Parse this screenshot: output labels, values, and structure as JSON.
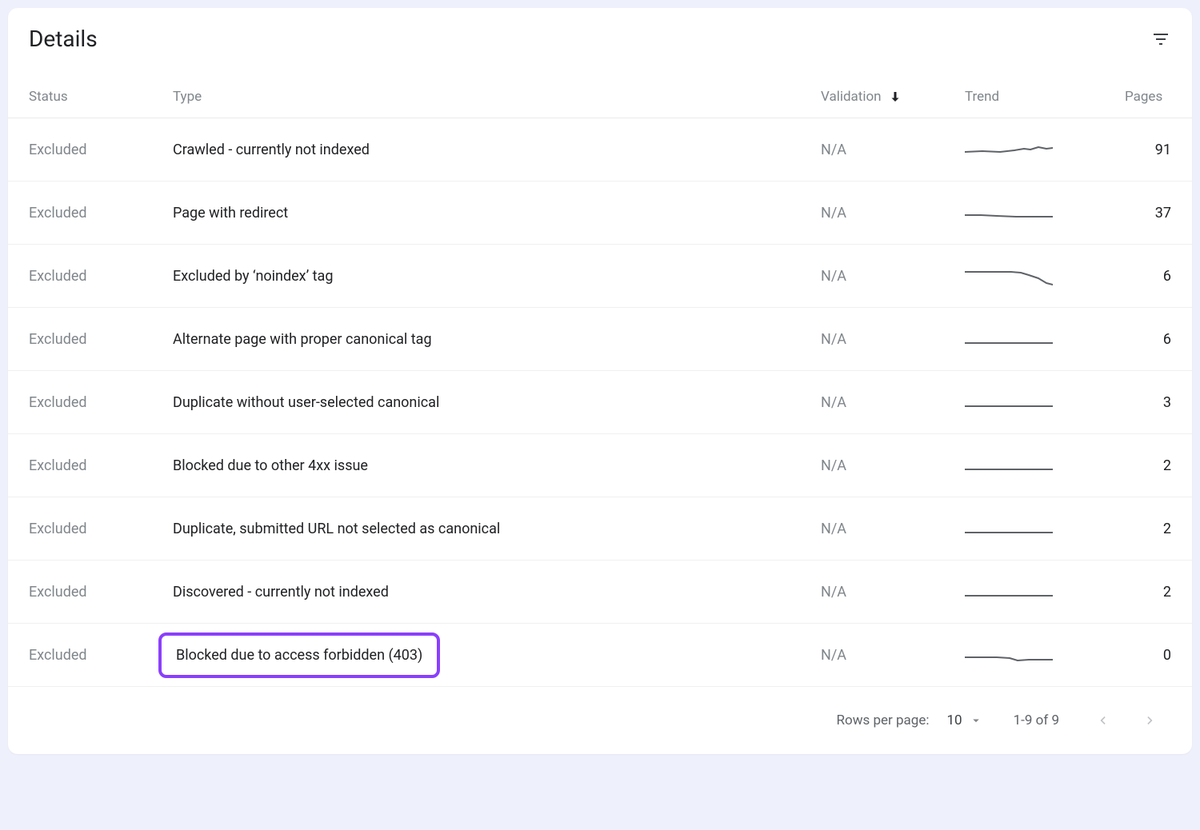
{
  "header": {
    "title": "Details"
  },
  "columns": {
    "status": "Status",
    "type": "Type",
    "validation": "Validation",
    "trend": "Trend",
    "pages": "Pages",
    "sort_column": "validation",
    "sort_direction": "desc"
  },
  "rows": [
    {
      "status": "Excluded",
      "type": "Crawled - currently not indexed",
      "validation": "N/A",
      "trend": "spark1",
      "pages": 91,
      "highlighted": false
    },
    {
      "status": "Excluded",
      "type": "Page with redirect",
      "validation": "N/A",
      "trend": "spark2",
      "pages": 37,
      "highlighted": false
    },
    {
      "status": "Excluded",
      "type": "Excluded by ‘noindex’ tag",
      "validation": "N/A",
      "trend": "spark3",
      "pages": 6,
      "highlighted": false
    },
    {
      "status": "Excluded",
      "type": "Alternate page with proper canonical tag",
      "validation": "N/A",
      "trend": "flat",
      "pages": 6,
      "highlighted": false
    },
    {
      "status": "Excluded",
      "type": "Duplicate without user-selected canonical",
      "validation": "N/A",
      "trend": "flat",
      "pages": 3,
      "highlighted": false
    },
    {
      "status": "Excluded",
      "type": "Blocked due to other 4xx issue",
      "validation": "N/A",
      "trend": "flat",
      "pages": 2,
      "highlighted": false
    },
    {
      "status": "Excluded",
      "type": "Duplicate, submitted URL not selected as canonical",
      "validation": "N/A",
      "trend": "flat",
      "pages": 2,
      "highlighted": false
    },
    {
      "status": "Excluded",
      "type": "Discovered - currently not indexed",
      "validation": "N/A",
      "trend": "flat",
      "pages": 2,
      "highlighted": false
    },
    {
      "status": "Excluded",
      "type": "Blocked due to access forbidden (403)",
      "validation": "N/A",
      "trend": "dip",
      "pages": 0,
      "highlighted": true
    }
  ],
  "pagination": {
    "rows_per_page_label": "Rows per page:",
    "rows_per_page_value": "10",
    "range_text": "1-9 of 9",
    "prev_enabled": false,
    "next_enabled": false
  },
  "sparklines": {
    "spark1": "0,18 22,17 44,18 62,16 74,14 82,15 92,12 102,14 110,13",
    "spark2": "0,18 20,18 40,19 64,20 84,20 104,20 110,20",
    "spark3": "0,10 30,10 58,10 70,11 80,14 92,18 102,24 110,26",
    "flat": "0,20 110,20",
    "dip": "0,18 40,18 56,19 66,22 80,21 90,21 110,21"
  }
}
